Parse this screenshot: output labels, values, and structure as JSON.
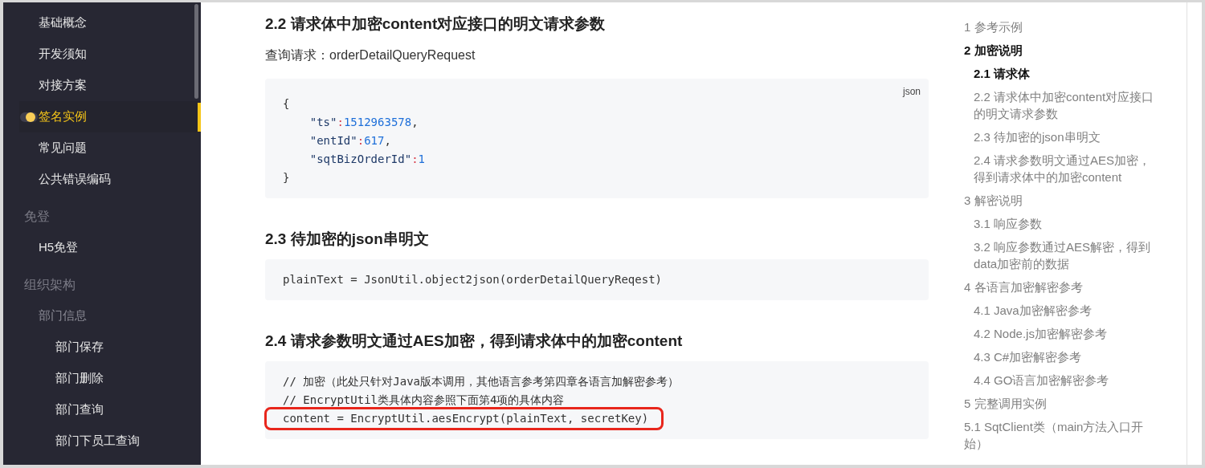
{
  "sidebar": {
    "items": [
      {
        "label": "基础概念",
        "kind": "item",
        "selected": false
      },
      {
        "label": "开发须知",
        "kind": "item",
        "selected": false
      },
      {
        "label": "对接方案",
        "kind": "item",
        "selected": false
      },
      {
        "label": "签名实例",
        "kind": "item",
        "selected": true
      },
      {
        "label": "常见问题",
        "kind": "item",
        "selected": false
      },
      {
        "label": "公共错误编码",
        "kind": "item",
        "selected": false
      },
      {
        "label": "免登",
        "kind": "group",
        "selected": false
      },
      {
        "label": "H5免登",
        "kind": "item",
        "selected": false
      },
      {
        "label": "组织架构",
        "kind": "group",
        "selected": false
      },
      {
        "label": "部门信息",
        "kind": "subgroup",
        "selected": false
      },
      {
        "label": "部门保存",
        "kind": "subitem",
        "selected": false
      },
      {
        "label": "部门删除",
        "kind": "subitem",
        "selected": false
      },
      {
        "label": "部门查询",
        "kind": "subitem",
        "selected": false
      },
      {
        "label": "部门下员工查询",
        "kind": "subitem",
        "selected": false
      }
    ]
  },
  "content": [
    {
      "kind": "heading",
      "text": "2.2 请求体中加密content对应接口的明文请求参数"
    },
    {
      "kind": "paragraph",
      "text": "查询请求：orderDetailQueryRequest"
    },
    {
      "kind": "code",
      "language": "json",
      "lines": [
        {
          "highlighted": false,
          "tokens": [
            {
              "kind": "plain",
              "text": "{"
            }
          ]
        },
        {
          "highlighted": false,
          "tokens": [
            {
              "kind": "key",
              "text": "    \"ts\""
            },
            {
              "kind": "colon",
              "text": ":"
            },
            {
              "kind": "number",
              "text": "1512963578"
            },
            {
              "kind": "plain",
              "text": ","
            }
          ]
        },
        {
          "highlighted": false,
          "tokens": [
            {
              "kind": "key",
              "text": "    \"entId\""
            },
            {
              "kind": "colon",
              "text": ":"
            },
            {
              "kind": "number",
              "text": "617"
            },
            {
              "kind": "plain",
              "text": ","
            }
          ]
        },
        {
          "highlighted": false,
          "tokens": [
            {
              "kind": "key",
              "text": "    \"sqtBizOrderId\""
            },
            {
              "kind": "colon",
              "text": ":"
            },
            {
              "kind": "number",
              "text": "1"
            }
          ]
        },
        {
          "highlighted": false,
          "tokens": [
            {
              "kind": "plain",
              "text": "}"
            }
          ]
        }
      ]
    },
    {
      "kind": "heading",
      "text": "2.3 待加密的json串明文"
    },
    {
      "kind": "code",
      "lines": [
        {
          "highlighted": false,
          "tokens": [
            {
              "kind": "plain",
              "text": "plainText = JsonUtil.object2json(orderDetailQueryReqest)"
            }
          ]
        }
      ]
    },
    {
      "kind": "heading",
      "text": "2.4 请求参数明文通过AES加密，得到请求体中的加密content"
    },
    {
      "kind": "code",
      "lines": [
        {
          "highlighted": false,
          "tokens": [
            {
              "kind": "plain",
              "text": "// 加密（此处只针对Java版本调用，其他语言参考第四章各语言加解密参考）"
            }
          ]
        },
        {
          "highlighted": false,
          "tokens": [
            {
              "kind": "plain",
              "text": "// EncryptUtil类具体内容参照下面第4项的具体内容"
            }
          ]
        },
        {
          "highlighted": true,
          "tokens": [
            {
              "kind": "plain",
              "text": "content = EncryptUtil.aesEncrypt(plainText, secretKey)"
            }
          ]
        }
      ]
    }
  ],
  "toc": [
    {
      "label": "1 参考示例",
      "active": false
    },
    {
      "label": "2 加密说明",
      "active": true,
      "children": [
        {
          "label": "2.1 请求体",
          "active": true
        },
        {
          "label": "2.2 请求体中加密content对应接口的明文请求参数",
          "active": false
        },
        {
          "label": "2.3 待加密的json串明文",
          "active": false
        },
        {
          "label": "2.4 请求参数明文通过AES加密，得到请求体中的加密content",
          "active": false
        }
      ]
    },
    {
      "label": "3 解密说明",
      "active": false,
      "children": [
        {
          "label": "3.1 响应参数",
          "active": false
        },
        {
          "label": "3.2 响应参数通过AES解密，得到data加密前的数据",
          "active": false
        }
      ]
    },
    {
      "label": "4 各语言加密解密参考",
      "active": false,
      "children": [
        {
          "label": "4.1 Java加密解密参考",
          "active": false
        },
        {
          "label": "4.2 Node.js加密解密参考",
          "active": false
        },
        {
          "label": "4.3 C#加密解密参考",
          "active": false
        },
        {
          "label": "4.4 GO语言加密解密参考",
          "active": false
        }
      ]
    },
    {
      "label": "5 完整调用实例",
      "active": false
    },
    {
      "label": "5.1 SqtClient类（main方法入口开始）",
      "active": false
    }
  ]
}
